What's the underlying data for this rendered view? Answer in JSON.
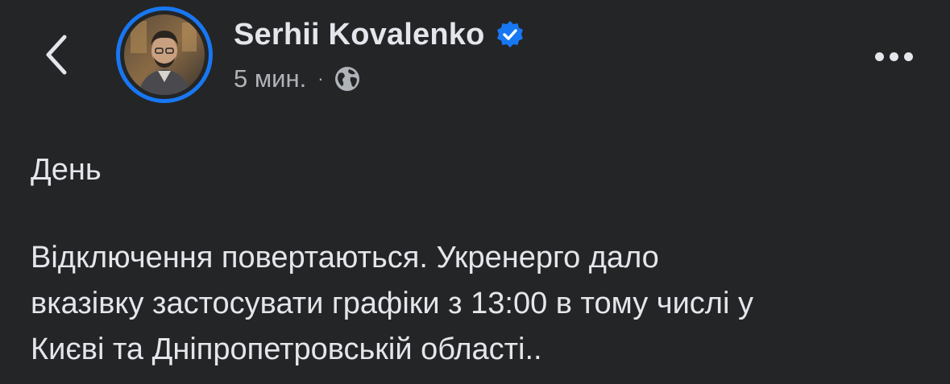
{
  "header": {
    "author_name": "Serhii Kovalenko",
    "verified": true,
    "timestamp": "5 мин.",
    "separator": "·",
    "audience_icon": "globe-icon",
    "back_icon": "chevron-left-icon",
    "more_icon": "more-horizontal-icon",
    "colors": {
      "background": "#242526",
      "accent_ring": "#1877f2",
      "verified_badge": "#1877f2",
      "primary_text": "#e4e6eb",
      "secondary_text": "#b0b3b8"
    }
  },
  "post": {
    "paragraphs": [
      "День",
      "Відключення повертаються. Укренерго дало\nвказівку застосувати графіки з 13:00 в тому числі у\nКиєві та Дніпропетровській області.."
    ]
  }
}
